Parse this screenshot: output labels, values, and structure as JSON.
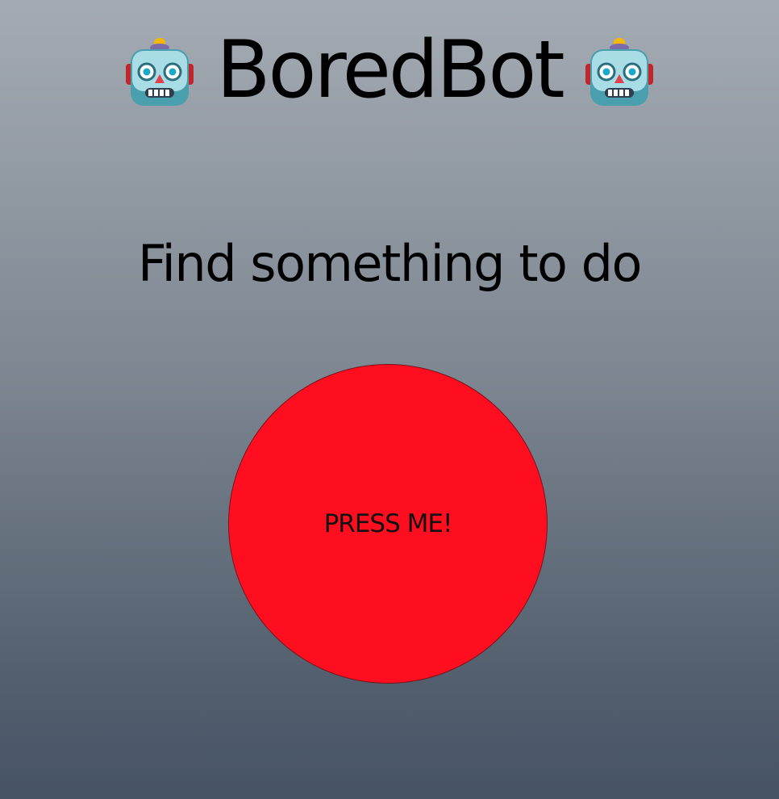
{
  "header": {
    "title": "BoredBot",
    "left_icon": "robot-face-icon",
    "right_icon": "robot-face-icon"
  },
  "main": {
    "subtitle": "Find something to do",
    "button_label": "PRESS ME!"
  },
  "colors": {
    "background_top": "#a4abb3",
    "background_bottom": "#465365",
    "button_fill": "#ff0e1f",
    "button_border": "#7a1219",
    "text": "#000000"
  }
}
